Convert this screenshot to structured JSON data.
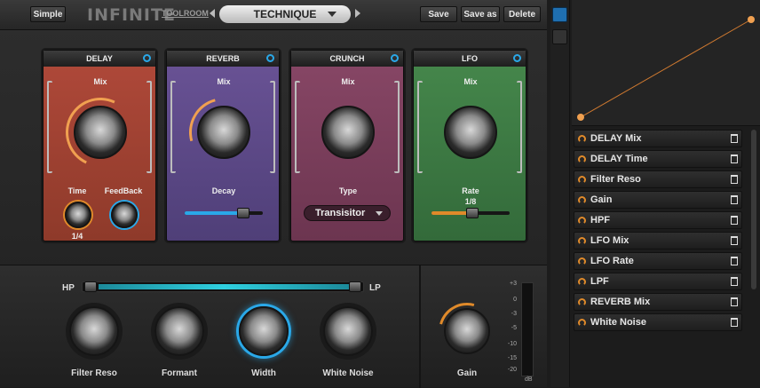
{
  "toolbar": {
    "simple": "Simple",
    "logo": "INFINITE",
    "brand": "TOOLROOM",
    "preset": "TECHNIQUE",
    "save": "Save",
    "save_as": "Save as",
    "delete": "Delete"
  },
  "modules": [
    {
      "title": "DELAY",
      "mix_label": "Mix",
      "time_label": "Time",
      "time_value": "1/4",
      "feedback_label": "FeedBack"
    },
    {
      "title": "REVERB",
      "mix_label": "Mix",
      "decay_label": "Decay"
    },
    {
      "title": "CRUNCH",
      "mix_label": "Mix",
      "type_label": "Type",
      "type_value": "Transisitor"
    },
    {
      "title": "LFO",
      "mix_label": "Mix",
      "rate_label": "Rate",
      "rate_value": "1/8"
    }
  ],
  "filter": {
    "hp": "HP",
    "lp": "LP"
  },
  "bottom_knobs": [
    "Filter Reso",
    "Formant",
    "Width",
    "White Noise"
  ],
  "gain": {
    "label": "Gain",
    "scale": [
      "+3",
      "0",
      "-3",
      "-5",
      "-10",
      "-15",
      "-20"
    ],
    "unit": "dB"
  },
  "mod_list": [
    "DELAY Mix",
    "DELAY Time",
    "Filter Reso",
    "Gain",
    "HPF",
    "LFO Mix",
    "LFO Rate",
    "LPF",
    "REVERB Mix",
    "White Noise"
  ],
  "colors": {
    "delay": "#a5432f",
    "reverb": "#5e4a88",
    "crunch": "#7c3f5e",
    "lfo": "#3d7a44",
    "accent_blue": "#2aa8e8",
    "accent_orange": "#e08a2a"
  }
}
